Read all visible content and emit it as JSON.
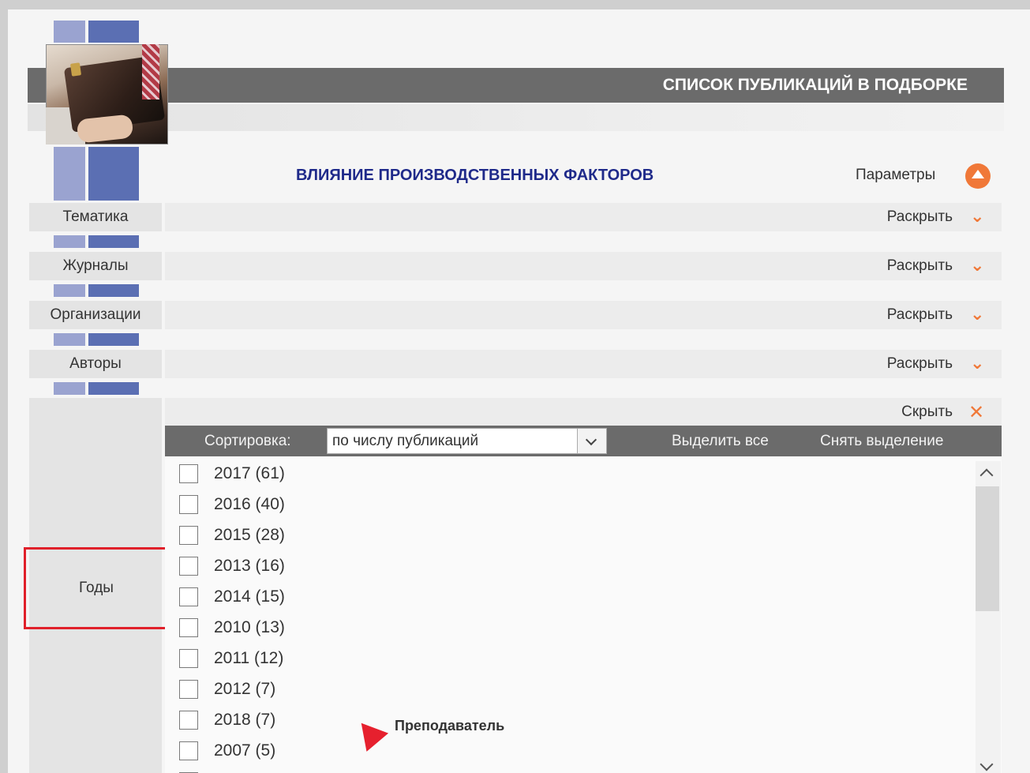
{
  "header": {
    "title": "СПИСОК ПУБЛИКАЦИЙ В ПОДБОРКЕ"
  },
  "collection": {
    "title": "ВЛИЯНИЕ ПРОИЗВОДСТВЕННЫХ ФАКТОРОВ",
    "params_label": "Параметры"
  },
  "sections": [
    {
      "label": "Тематика",
      "action": "Раскрыть"
    },
    {
      "label": "Журналы",
      "action": "Раскрыть"
    },
    {
      "label": "Организации",
      "action": "Раскрыть"
    },
    {
      "label": "Авторы",
      "action": "Раскрыть"
    }
  ],
  "years": {
    "label": "Годы",
    "hide_label": "Скрыть",
    "sort_label": "Сортировка:",
    "sort_value": "по числу публикаций",
    "select_all": "Выделить все",
    "clear_selection": "Снять выделение",
    "items": [
      {
        "text": "2017  (61)"
      },
      {
        "text": "2016  (40)"
      },
      {
        "text": "2015  (28)"
      },
      {
        "text": "2013  (16)"
      },
      {
        "text": "2014  (15)"
      },
      {
        "text": "2010  (13)"
      },
      {
        "text": "2011  (12)"
      },
      {
        "text": "2012  (7)"
      },
      {
        "text": "2018  (7)"
      },
      {
        "text": "2007  (5)"
      }
    ]
  },
  "cursor": {
    "label": "Преподаватель"
  },
  "colors": {
    "accent": "#f07838",
    "header_bg": "#6b6b6b",
    "title_blue": "#1f2a8a",
    "highlight_red": "#e0202a"
  }
}
